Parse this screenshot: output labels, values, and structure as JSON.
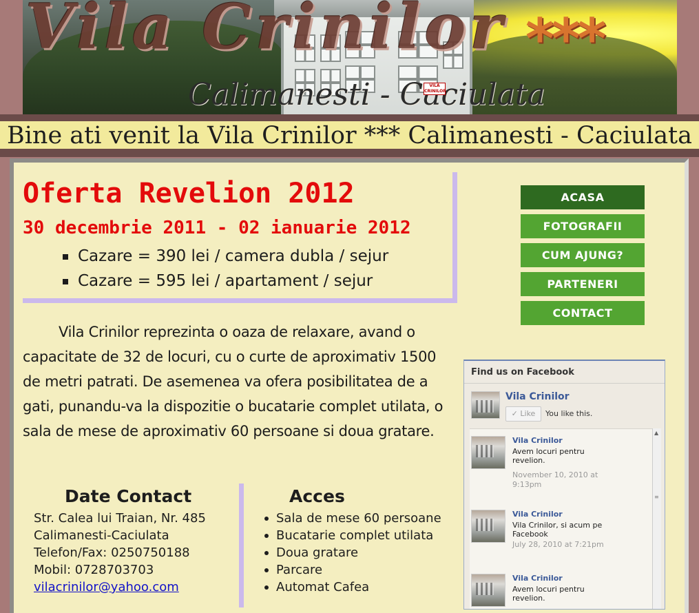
{
  "banner": {
    "title": "Vila Crinilor",
    "stars": "***",
    "subtitle": "Calimanesti - Caciulata",
    "sign": "VILA CRINILOR"
  },
  "welcome": "Bine ati venit la Vila Crinilor *** Calimanesti - Caciulata",
  "offer": {
    "title": "Oferta Revelion 2012",
    "dates": "30 decembrie 2011 - 02 ianuarie 2012",
    "items": [
      "Cazare = 390 lei / camera dubla / sejur",
      "Cazare = 595 lei / apartament / sejur"
    ]
  },
  "description": "Vila Crinilor reprezinta o oaza de relaxare, avand o capacitate de 32 de locuri, cu o curte de aproximativ 1500 de metri patrati. De asemenea va ofera posibilitatea de a gati, punandu-va la dispozitie o bucatarie complet utilata, o sala de mese de aproximativ 60 persoane si doua gratare.",
  "contact": {
    "heading": "Date Contact",
    "lines": [
      "Str. Calea lui Traian, Nr. 485",
      "Calimanesti-Caciulata",
      "Telefon/Fax: 0250750188",
      "Mobil: 0728703703"
    ],
    "email": "vilacrinilor@yahoo.com"
  },
  "acces": {
    "heading": "Acces",
    "items": [
      "Sala de mese 60 persoane",
      "Bucatarie complet utilata",
      "Doua gratare",
      "Parcare",
      "Automat Cafea"
    ]
  },
  "nav": {
    "items": [
      {
        "label": "ACASA",
        "active": true
      },
      {
        "label": "FOTOGRAFII"
      },
      {
        "label": "CUM AJUNG?"
      },
      {
        "label": "PARTENERI"
      },
      {
        "label": "CONTACT"
      }
    ]
  },
  "facebook": {
    "header": "Find us on Facebook",
    "page_name": "Vila Crinilor",
    "like_label": "Like",
    "you_like": "You like this.",
    "posts": [
      {
        "author": "Vila Crinilor",
        "message": "Avem locuri pentru revelion.",
        "time": "November 10, 2010 at 9:13pm"
      },
      {
        "author": "Vila Crinilor",
        "message": "Vila Crinilor, si acum pe Facebook",
        "time": "July 28, 2010 at 7:21pm"
      },
      {
        "author": "Vila Crinilor",
        "message": "Avem locuri pentru revelion.",
        "time": ""
      }
    ]
  },
  "colors": {
    "offer_red": "#e30b0b",
    "nav_green": "#53a532",
    "nav_active": "#2e6a20",
    "accent_lavender": "#cbb9ec",
    "panel_bg": "#f4eec0"
  }
}
